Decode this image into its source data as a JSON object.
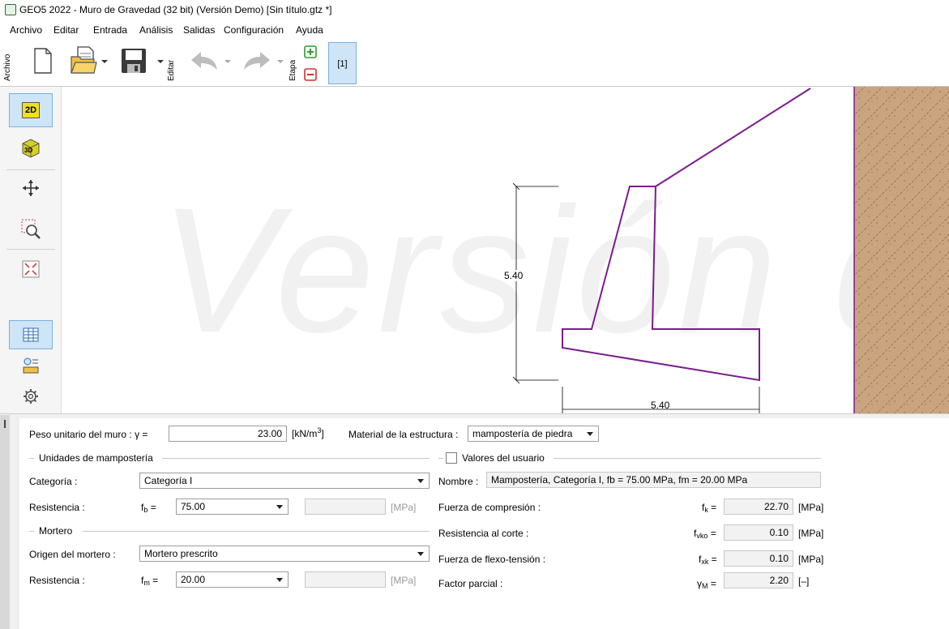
{
  "window": {
    "title": "GEO5 2022 - Muro de Gravedad (32 bit) (Versión Demo) [Sin título.gtz *]"
  },
  "menu": [
    "Archivo",
    "Editar",
    "Entrada",
    "Análisis",
    "Salidas",
    "Configuración",
    "Ayuda"
  ],
  "toolbar": {
    "file_label": "Archivo",
    "edit_label": "Editar",
    "stage_label": "Etapa",
    "stage_button": "[1]"
  },
  "left_toolbar": {
    "btn_2d": "2D",
    "btn_3d": "3D"
  },
  "canvas": {
    "watermark": "Versión de",
    "dim_height": "5.40",
    "dim_width": "5.40",
    "wall_color": "#7b1c8c",
    "soil_color": "#c9a47e"
  },
  "form": {
    "unit_weight_label": "Peso unitario del muro : γ =",
    "unit_weight_value": "23.00",
    "unit_weight_unit": "[kN/m",
    "unit_weight_unit_sup": "3",
    "unit_weight_unit_end": "]",
    "material_label": "Material de la estructura :",
    "material_value": "mampostería de piedra",
    "masonry_units_group": "Unidades de mampostería",
    "category_label": "Categoría :",
    "category_value": "Categoría I",
    "strength_label": "Resistencia :",
    "fb_symbol": "f",
    "fb_sub": "b",
    "fb_eq": " =",
    "fb_value": "75.00",
    "mpa_unit": "[MPa]",
    "mortar_group": "Mortero",
    "mortar_origin_label": "Origen del mortero :",
    "mortar_origin_value": "Mortero prescrito",
    "mortar_strength_label": "Resistencia :",
    "fm_symbol": "f",
    "fm_sub": "m",
    "fm_eq": " =",
    "fm_value": "20.00",
    "user_values_label": "Valores del usuario",
    "name_label": "Nombre :",
    "name_value": "Mampostería, Categoría I, fb = 75.00 MPa, fm = 20.00 MPa",
    "compression_label": "Fuerza de compresión :",
    "fk_symbol": "f",
    "fk_sub": "k",
    "fk_eq": " =",
    "fk_value": "22.70",
    "fk_unit": "[MPa]",
    "shear_label": "Resistencia al corte :",
    "fvko_symbol": "f",
    "fvko_sub": "vko",
    "fvko_eq": " =",
    "fvko_value": "0.10",
    "fvko_unit": "[MPa]",
    "flex_label": "Fuerza de flexo-tensión :",
    "fxk_symbol": "f",
    "fxk_sub": "xk",
    "fxk_eq": " =",
    "fxk_value": "0.10",
    "fxk_unit": "[MPa]",
    "partial_label": "Factor parcial :",
    "gm_symbol": "γ",
    "gm_sub": "M",
    "gm_eq": " =",
    "gm_value": "2.20",
    "gm_unit": "[–]"
  }
}
